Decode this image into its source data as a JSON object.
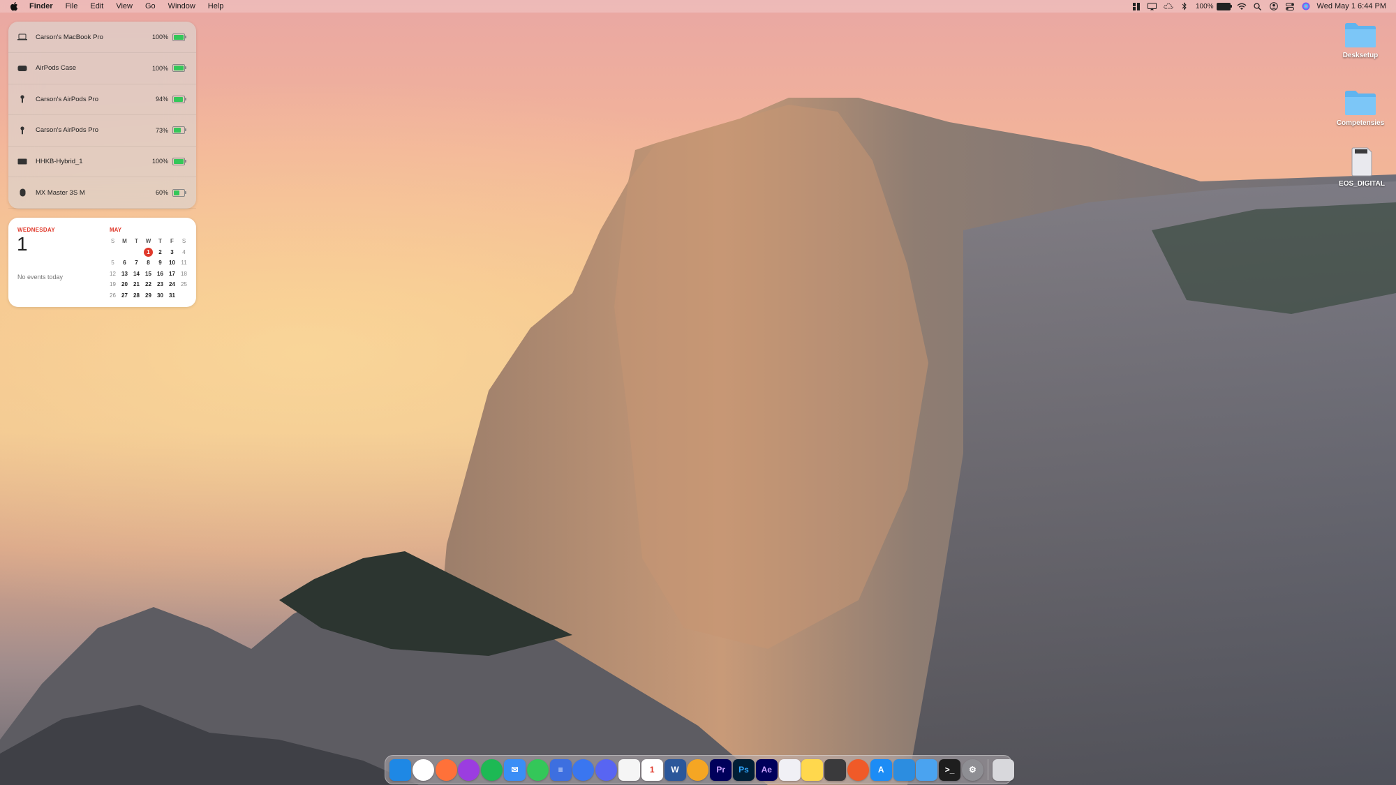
{
  "menubar": {
    "app_name": "Finder",
    "menus": [
      "File",
      "Edit",
      "View",
      "Go",
      "Window",
      "Help"
    ],
    "battery_percent": "100%",
    "datetime": "Wed May 1  6:44 PM"
  },
  "battery_widget": {
    "devices": [
      {
        "name": "Carson's MacBook Pro",
        "percent": "100%",
        "level": 1.0,
        "icon": "laptop-icon"
      },
      {
        "name": "AirPods Case",
        "percent": "100%",
        "level": 1.0,
        "icon": "airpods-case-icon"
      },
      {
        "name": "Carson's AirPods Pro",
        "percent": "94%",
        "level": 0.94,
        "icon": "airpod-icon"
      },
      {
        "name": "Carson's AirPods Pro",
        "percent": "73%",
        "level": 0.73,
        "icon": "airpod-icon"
      },
      {
        "name": "HHKB-Hybrid_1",
        "percent": "100%",
        "level": 1.0,
        "icon": "keyboard-icon"
      },
      {
        "name": "MX Master 3S M",
        "percent": "60%",
        "level": 0.6,
        "icon": "mouse-icon"
      }
    ],
    "bar_color": "#34c759"
  },
  "calendar_widget": {
    "day_name": "WEDNESDAY",
    "day_number": "1",
    "no_events": "No events today",
    "month": "MAY",
    "weekday_headers": [
      "S",
      "M",
      "T",
      "W",
      "T",
      "F",
      "S"
    ],
    "weeks": [
      [
        "",
        "",
        "",
        "1",
        "2",
        "3",
        "4"
      ],
      [
        "5",
        "6",
        "7",
        "8",
        "9",
        "10",
        "11"
      ],
      [
        "12",
        "13",
        "14",
        "15",
        "16",
        "17",
        "18"
      ],
      [
        "19",
        "20",
        "21",
        "22",
        "23",
        "24",
        "25"
      ],
      [
        "26",
        "27",
        "28",
        "29",
        "30",
        "31",
        ""
      ]
    ],
    "today": "1",
    "accent_color": "#e0392b"
  },
  "desktop_icons": [
    {
      "label": "Desksetup",
      "type": "folder"
    },
    {
      "label": "Competensies",
      "type": "folder"
    },
    {
      "label": "EOS_DIGITAL",
      "type": "drive"
    }
  ],
  "dock": {
    "apps": [
      {
        "name": "Finder",
        "glyph": "",
        "color": "#1e88e5",
        "icon": "finder-icon"
      },
      {
        "name": "Chrome",
        "glyph": "",
        "color": "#ffffff",
        "icon": "chrome-icon"
      },
      {
        "name": "Firefox",
        "glyph": "",
        "color": "#ff7139",
        "icon": "firefox-icon"
      },
      {
        "name": "Podcasts",
        "glyph": "",
        "color": "#9b3de0",
        "icon": "podcasts-icon"
      },
      {
        "name": "Spotify",
        "glyph": "",
        "color": "#1db954",
        "icon": "spotify-icon"
      },
      {
        "name": "Mail",
        "glyph": "✉",
        "color": "#3a8ef6",
        "icon": "mail-icon"
      },
      {
        "name": "Messages",
        "glyph": "",
        "color": "#34c759",
        "icon": "messages-icon"
      },
      {
        "name": "Docs",
        "glyph": "≡",
        "color": "#3d6fe0",
        "icon": "docs-icon"
      },
      {
        "name": "Signal",
        "glyph": "",
        "color": "#3a76f0",
        "icon": "signal-icon"
      },
      {
        "name": "Discord",
        "glyph": "",
        "color": "#5865f2",
        "icon": "discord-icon"
      },
      {
        "name": "Photos",
        "glyph": "",
        "color": "#f5f5f5",
        "icon": "photos-icon"
      },
      {
        "name": "Calendar",
        "glyph": "1",
        "color": "#ffffff",
        "icon": "calendar-icon"
      },
      {
        "name": "Word",
        "glyph": "W",
        "color": "#2b579a",
        "icon": "word-icon"
      },
      {
        "name": "Headphones",
        "glyph": "",
        "color": "#f5a623",
        "icon": "headphones-icon"
      },
      {
        "name": "Premiere Pro",
        "glyph": "Pr",
        "color": "#00005b",
        "icon": "premiere-icon"
      },
      {
        "name": "Photoshop",
        "glyph": "Ps",
        "color": "#001e36",
        "icon": "photoshop-icon"
      },
      {
        "name": "After Effects",
        "glyph": "Ae",
        "color": "#00005b",
        "icon": "after-effects-icon"
      },
      {
        "name": "Pages",
        "glyph": "",
        "color": "#f0f0f5",
        "icon": "pen-icon"
      },
      {
        "name": "Notes",
        "glyph": "",
        "color": "#ffd84d",
        "icon": "notes-icon"
      },
      {
        "name": "Keyboard",
        "glyph": "",
        "color": "#3a3a3c",
        "icon": "keyboard-app-icon"
      },
      {
        "name": "Toolbox",
        "glyph": "",
        "color": "#f05a28",
        "icon": "tool-icon"
      },
      {
        "name": "App Store",
        "glyph": "A",
        "color": "#1c8cf5",
        "icon": "app-store-icon"
      },
      {
        "name": "VS Code",
        "glyph": "",
        "color": "#2c8de0",
        "icon": "vscode-icon"
      },
      {
        "name": "Xcode",
        "glyph": "",
        "color": "#4aa3f0",
        "icon": "xcode-icon"
      },
      {
        "name": "Terminal",
        "glyph": ">_",
        "color": "#1e1e1e",
        "icon": "terminal-icon"
      },
      {
        "name": "System Settings",
        "glyph": "⚙",
        "color": "#8e8e93",
        "icon": "settings-icon"
      },
      {
        "name": "Trash",
        "glyph": "",
        "color": "#d8d8dc",
        "icon": "trash-icon"
      }
    ]
  }
}
